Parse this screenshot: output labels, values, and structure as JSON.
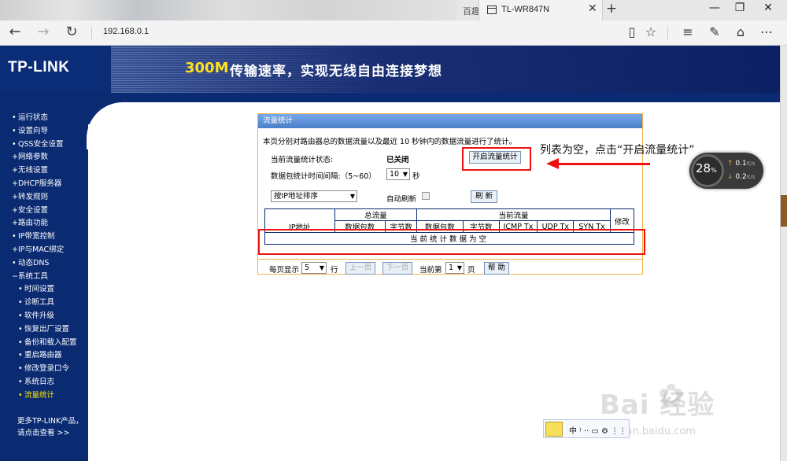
{
  "browser": {
    "prev_tab_text": "百趣",
    "active_tab_title": "TL-WR847N",
    "address": "192.168.0.1",
    "icons": [
      "back-icon",
      "forward-icon",
      "refresh-icon",
      "reading-view-icon",
      "favorite-star-icon",
      "hub-icon",
      "notes-icon",
      "share-icon",
      "more-icon"
    ]
  },
  "banner": {
    "logo": "TP-LINK",
    "speed": "300M",
    "slogan": "传输速率，实现无线自由连接梦想"
  },
  "sidebar": {
    "items": [
      {
        "label": "运行状态",
        "bullet": "•"
      },
      {
        "label": "设置向导",
        "bullet": "•"
      },
      {
        "label": "QSS安全设置",
        "bullet": "•"
      },
      {
        "label": "网络参数",
        "bullet": "+"
      },
      {
        "label": "无线设置",
        "bullet": "+"
      },
      {
        "label": "DHCP服务器",
        "bullet": "+"
      },
      {
        "label": "转发规则",
        "bullet": "+"
      },
      {
        "label": "安全设置",
        "bullet": "+"
      },
      {
        "label": "路由功能",
        "bullet": "+"
      },
      {
        "label": "IP带宽控制",
        "bullet": "•"
      },
      {
        "label": "IP与MAC绑定",
        "bullet": "+"
      },
      {
        "label": "动态DNS",
        "bullet": "•"
      },
      {
        "label": "系统工具",
        "bullet": "−"
      }
    ],
    "sub_items": [
      "时间设置",
      "诊断工具",
      "软件升级",
      "恢复出厂设置",
      "备份和载入配置",
      "重启路由器",
      "修改登录口令",
      "系统日志",
      "流量统计"
    ],
    "more_line1": "更多TP-LINK产品，",
    "more_line2": "请点击查看 >>"
  },
  "panel": {
    "title": "流量统计",
    "description": "本页分别对路由器总的数据流量以及最近 10 秒钟内的数据流量进行了统计。",
    "status_label": "当前流量统计状态:",
    "status_value": "已关闭",
    "enable_button": "开启流量统计",
    "interval_label": "数据包统计时间间隔:（5~60）",
    "interval_value": "10",
    "interval_unit": "秒",
    "sort_value": "按IP地址排序",
    "auto_refresh_label": "自动刷新",
    "refresh_button": "刷 新",
    "table": {
      "group_total": "总流量",
      "group_current": "当前流量",
      "col_ip": "IP地址",
      "col_packets": "数据包数",
      "col_bytes": "字节数",
      "col_cur_packets": "数据包数",
      "col_cur_bytes": "字节数",
      "col_icmp": "ICMP Tx",
      "col_udp": "UDP Tx",
      "col_syn": "SYN Tx",
      "col_edit": "修改",
      "empty_text": "当前统计数据为空"
    },
    "per_page_label": "每页显示",
    "per_page_value": "5",
    "rows_unit": "行",
    "prev_button": "上一页",
    "next_button": "下一页",
    "current_page_label": "当前第",
    "current_page_value": "1",
    "page_unit": "页",
    "help_button": "帮 助"
  },
  "annotation": "列表为空，点击“开启流量统计”",
  "net_widget": {
    "percent": "28",
    "pct_sign": "%",
    "up": "0.1",
    "down": "0.2",
    "unit": "K/s"
  },
  "ime": {
    "text": "中 ⁾ ·· ▭ ⚙ ⋮⋮"
  },
  "watermark": {
    "line1": "Bai 经验",
    "line2": "jingyan.baidu.com"
  },
  "colors": {
    "navy": "#0a2a72",
    "panel_border": "#f2b24c",
    "annotation_red": "#e11111",
    "accent_yellow": "#ffe21a"
  }
}
